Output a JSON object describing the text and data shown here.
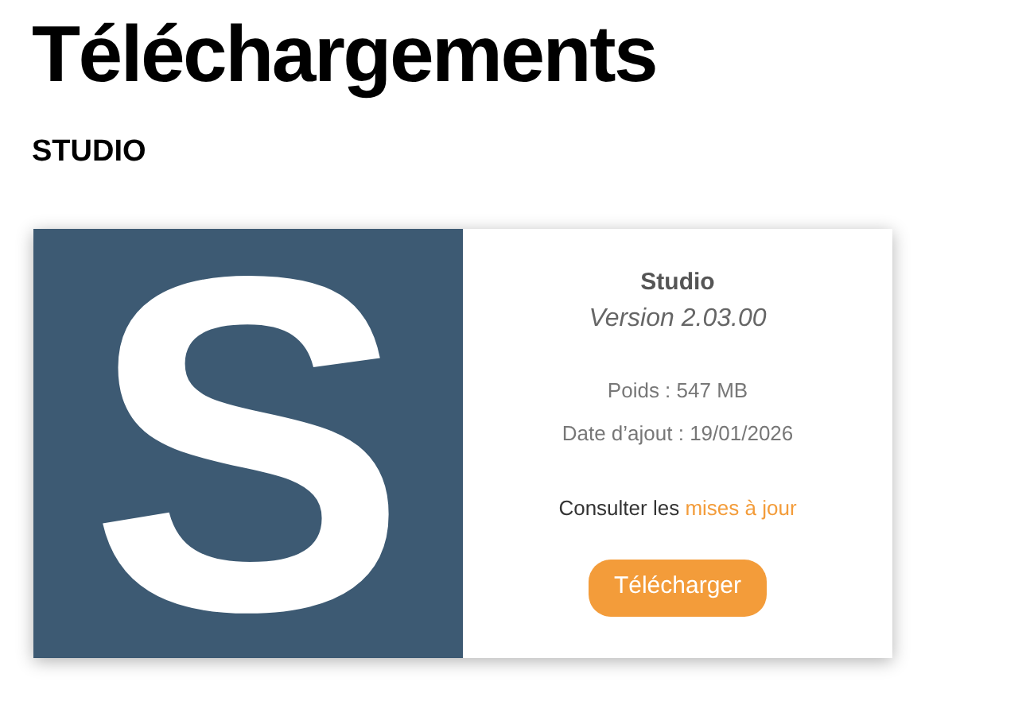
{
  "title": "Téléchargements",
  "section": "STUDIO",
  "card": {
    "logo": "S",
    "name": "Studio",
    "version": "Version 2.03.00",
    "size": "Poids : 547 MB",
    "date": "Date d’ajout : 19/01/2026",
    "updates_text": "Consulter les",
    "updates_link": "mises à jour",
    "button": "Télécharger"
  }
}
